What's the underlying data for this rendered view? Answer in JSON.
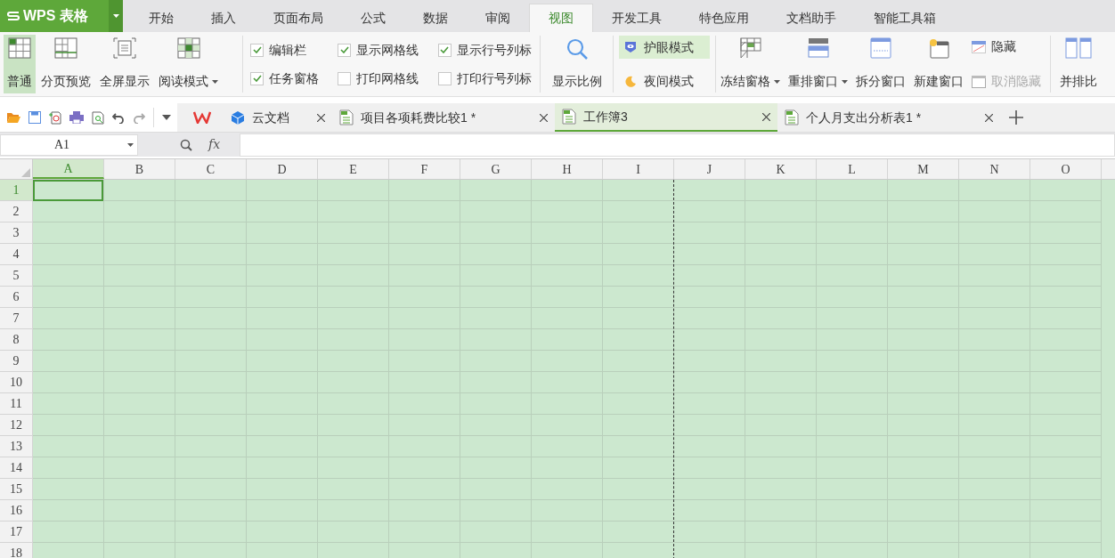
{
  "app": {
    "title": "WPS 表格"
  },
  "menu_tabs": [
    {
      "label": "开始",
      "selected": false
    },
    {
      "label": "插入",
      "selected": false
    },
    {
      "label": "页面布局",
      "selected": false
    },
    {
      "label": "公式",
      "selected": false
    },
    {
      "label": "数据",
      "selected": false
    },
    {
      "label": "审阅",
      "selected": false
    },
    {
      "label": "视图",
      "selected": true
    },
    {
      "label": "开发工具",
      "selected": false
    },
    {
      "label": "特色应用",
      "selected": false
    },
    {
      "label": "文档助手",
      "selected": false
    },
    {
      "label": "智能工具箱",
      "selected": false
    }
  ],
  "ribbon": {
    "view_modes": [
      {
        "label": "普通",
        "selected": true,
        "dropdown": false
      },
      {
        "label": "分页预览",
        "selected": false,
        "dropdown": false
      },
      {
        "label": "全屏显示",
        "selected": false,
        "dropdown": false
      },
      {
        "label": "阅读模式",
        "selected": false,
        "dropdown": true
      }
    ],
    "checkboxes": [
      {
        "label": "编辑栏",
        "checked": true
      },
      {
        "label": "任务窗格",
        "checked": true
      },
      {
        "label": "显示网格线",
        "checked": true
      },
      {
        "label": "打印网格线",
        "checked": false
      },
      {
        "label": "显示行号列标",
        "checked": true
      },
      {
        "label": "打印行号列标",
        "checked": false
      }
    ],
    "zoom": {
      "label": "显示比例"
    },
    "eye_mode": {
      "label": "护眼模式",
      "on": true
    },
    "night_mode": {
      "label": "夜间模式",
      "on": false
    },
    "window_buttons": [
      {
        "label": "冻结窗格",
        "dropdown": true
      },
      {
        "label": "重排窗口",
        "dropdown": true
      },
      {
        "label": "拆分窗口",
        "dropdown": false
      },
      {
        "label": "新建窗口",
        "dropdown": false
      }
    ],
    "hide": {
      "label": "隐藏",
      "disabled": false
    },
    "unhide": {
      "label": "取消隐藏",
      "disabled": true
    },
    "side_by_side": {
      "label": "并排比"
    }
  },
  "doc_tabs": [
    {
      "label": "云文档",
      "kind": "cloud",
      "selected": false
    },
    {
      "label": "项目各项耗费比较1 *",
      "kind": "sheet",
      "selected": false
    },
    {
      "label": "工作簿3",
      "kind": "sheet",
      "selected": true
    },
    {
      "label": "个人月支出分析表1 *",
      "kind": "sheet",
      "selected": false
    }
  ],
  "name_box": {
    "value": "A1"
  },
  "formula": {
    "fx": "fx"
  },
  "columns": [
    {
      "label": "A",
      "selected": true,
      "page_break": false
    },
    {
      "label": "B",
      "selected": false,
      "page_break": false
    },
    {
      "label": "C",
      "selected": false,
      "page_break": false
    },
    {
      "label": "D",
      "selected": false,
      "page_break": false
    },
    {
      "label": "E",
      "selected": false,
      "page_break": false
    },
    {
      "label": "F",
      "selected": false,
      "page_break": false
    },
    {
      "label": "G",
      "selected": false,
      "page_break": false
    },
    {
      "label": "H",
      "selected": false,
      "page_break": false
    },
    {
      "label": "I",
      "selected": false,
      "page_break": true
    },
    {
      "label": "J",
      "selected": false,
      "page_break": false
    },
    {
      "label": "K",
      "selected": false,
      "page_break": false
    },
    {
      "label": "L",
      "selected": false,
      "page_break": false
    },
    {
      "label": "M",
      "selected": false,
      "page_break": false
    },
    {
      "label": "N",
      "selected": false,
      "page_break": false
    },
    {
      "label": "O",
      "selected": false,
      "page_break": false
    }
  ],
  "rows": [
    {
      "label": "1",
      "selected": true
    },
    {
      "label": "2",
      "selected": false
    },
    {
      "label": "3",
      "selected": false
    },
    {
      "label": "4",
      "selected": false
    },
    {
      "label": "5",
      "selected": false
    },
    {
      "label": "6",
      "selected": false
    },
    {
      "label": "7",
      "selected": false
    },
    {
      "label": "8",
      "selected": false
    },
    {
      "label": "9",
      "selected": false
    },
    {
      "label": "10",
      "selected": false
    },
    {
      "label": "11",
      "selected": false
    },
    {
      "label": "12",
      "selected": false
    },
    {
      "label": "13",
      "selected": false
    },
    {
      "label": "14",
      "selected": false
    },
    {
      "label": "15",
      "selected": false
    },
    {
      "label": "16",
      "selected": false
    },
    {
      "label": "17",
      "selected": false
    },
    {
      "label": "18",
      "selected": false
    }
  ]
}
